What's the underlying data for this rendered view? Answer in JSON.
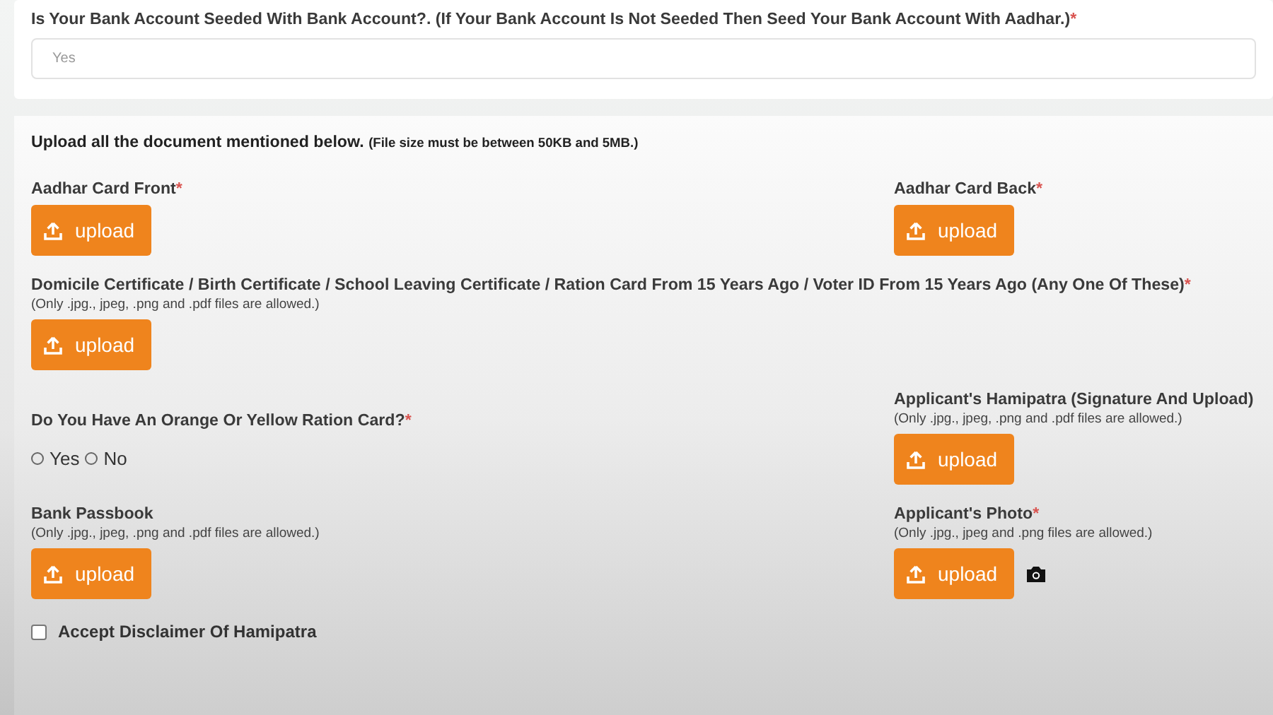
{
  "bank_seeding": {
    "label": "Is Your Bank Account Seeded With Bank Account?. (If Your Bank Account Is Not Seeded Then Seed Your Bank Account With Aadhar.)",
    "required_mark": "*",
    "value": "Yes"
  },
  "documents": {
    "heading": "Upload all the document mentioned below.",
    "size_note": "(File size must be between 50KB and 5MB.)",
    "rows": [
      [
        {
          "kind": "upload",
          "label": "Aadhar Card Front",
          "required_mark": "*",
          "button": "upload"
        },
        {
          "kind": "upload",
          "label": "Aadhar Card Back",
          "required_mark": "*",
          "button": "upload"
        }
      ],
      [
        {
          "kind": "upload",
          "label": "Domicile Certificate / Birth Certificate / School Leaving Certificate / Ration Card From 15 Years Ago / Voter ID From 15 Years Ago (Any One Of These)",
          "required_mark": "*",
          "note": "(Only .jpg., jpeg, .png and .pdf files are allowed.)",
          "button": "upload"
        }
      ],
      [
        {
          "kind": "radio",
          "label": "Do You Have An Orange Or Yellow Ration Card?",
          "required_mark": "*",
          "options": [
            {
              "label": "Yes",
              "selected": false
            },
            {
              "label": "No",
              "selected": false
            }
          ]
        },
        {
          "kind": "upload",
          "label": "Applicant's Hamipatra (Signature And Upload)",
          "note": "(Only .jpg., jpeg, .png and .pdf files are allowed.)",
          "button": "upload"
        }
      ],
      [
        {
          "kind": "upload",
          "label": "Bank Passbook",
          "note": "(Only .jpg., jpeg, .png and .pdf files are allowed.)",
          "button": "upload"
        },
        {
          "kind": "upload",
          "label": "Applicant's Photo",
          "required_mark": "*",
          "note": "(Only .jpg., jpeg and .png files are allowed.)",
          "button": "upload",
          "camera": true
        }
      ]
    ],
    "disclaimer": {
      "label": "Accept Disclaimer Of Hamipatra",
      "checked": false
    }
  }
}
